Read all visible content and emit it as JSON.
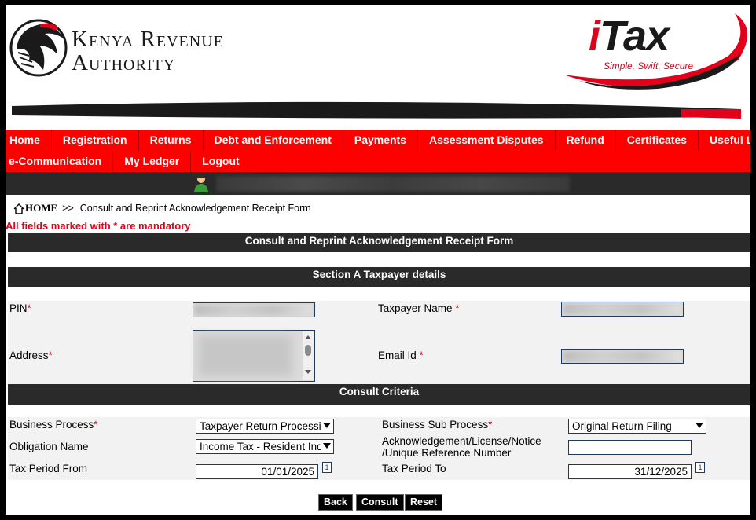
{
  "header": {
    "org_line1": "Kenya Revenue",
    "org_line2": "Authority",
    "logo_text": "iTax",
    "tagline": "Simple, Swift, Secure"
  },
  "nav": {
    "row1": [
      "Home",
      "Registration",
      "Returns",
      "Debt and Enforcement",
      "Payments",
      "Assessment Disputes",
      "Refund",
      "Certificates",
      "Useful Links"
    ],
    "row2": [
      "e-Communication",
      "My Ledger",
      "Logout"
    ]
  },
  "breadcrumb": {
    "home": "HOME",
    "separator": ">>",
    "current": "Consult and Reprint Acknowledgement Receipt Form"
  },
  "mandatory_note": "All fields marked with * are mandatory",
  "form": {
    "title": "Consult and Reprint Acknowledgement Receipt Form",
    "section_a": "Section A Taxpayer details",
    "pin_label": "PIN",
    "taxpayer_name_label": "Taxpayer Name ",
    "address_label": "Address",
    "email_label": "Email Id ",
    "req_mark": "*",
    "consult_criteria": "Consult Criteria",
    "business_process_label": "Business Process",
    "business_process_value": "Taxpayer Return Processing",
    "business_sub_process_label": "Business Sub Process",
    "business_sub_process_value": "Original Return Filing",
    "obligation_label": "Obligation Name",
    "obligation_value": "Income Tax - Resident Individual",
    "ack_label_line1": "Acknowledgement/License/Notice",
    "ack_label_line2": "/Unique Reference Number",
    "ack_value": "",
    "period_from_label": "Tax Period From",
    "period_from_value": "01/01/2025",
    "period_to_label": "Tax Period To",
    "period_to_value": "31/12/2025"
  },
  "buttons": {
    "back": "Back",
    "consult": "Consult",
    "reset": "Reset"
  },
  "colors": {
    "nav_red": "#ff0000",
    "dark_bar": "#2a2a2a",
    "accent_red": "#e2001a"
  }
}
